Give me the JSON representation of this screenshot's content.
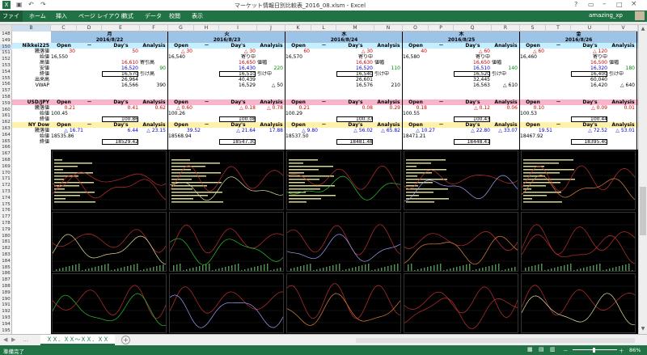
{
  "window": {
    "title": "マーケット情報日別比較表_2016_08.xlsm - Excel",
    "user": "amazing_xp"
  },
  "ribbon": {
    "tabs": [
      "ファイル",
      "ホーム",
      "挿入",
      "ページ レイアウト",
      "数式",
      "データ",
      "校閲",
      "表示"
    ]
  },
  "name_box": "B150",
  "columns": [
    "B",
    "C",
    "D",
    "E",
    "F",
    "G",
    "H",
    "I",
    "J",
    "K",
    "L",
    "M",
    "N",
    "O",
    "P",
    "Q",
    "R",
    "S",
    "T",
    "U",
    "V"
  ],
  "rows": [
    "148",
    "149",
    "150",
    "151",
    "152",
    "153",
    "154",
    "155",
    "156",
    "157",
    "158",
    "159",
    "160",
    "161",
    "162",
    "163",
    "164",
    "165",
    "166",
    "167",
    "168",
    "169",
    "170",
    "171",
    "172",
    "173",
    "174",
    "175",
    "176",
    "177",
    "178",
    "179",
    "180",
    "181",
    "182",
    "183",
    "184",
    "185",
    "186",
    "187",
    "188",
    "189",
    "190",
    "191",
    "192",
    "193",
    "194",
    "195"
  ],
  "row_labels": {
    "nikkei": "Nikkei225",
    "prev_close": "騰落値",
    "open_price": "始値",
    "high": "高値",
    "low": "安値",
    "close": "終値",
    "volume": "出来高",
    "vwap": "VWAP",
    "usdjpy": "USD/JPY",
    "nydow": "NY Dow"
  },
  "headers": {
    "open": "Open",
    "dash": "－",
    "days": "Day's",
    "analysis": "Analysis"
  },
  "days": [
    {
      "wday": "月",
      "date": "2016/8/22",
      "nk": {
        "chg": "30",
        "dchg": "50",
        "open": "16,550",
        "high": "16,610",
        "low": "16,520",
        "close": "16,570",
        "vol": "26,964",
        "vwap": "16,566",
        "tag1": "",
        "tag2": "寄引高",
        "tag3": "",
        "tag4": "引け高",
        "v1": "90",
        "v2": "390"
      },
      "fx": {
        "chg": "0.21",
        "dchg": "0.41",
        "ana": "0.62",
        "open": "100.45",
        "close": "100.86"
      },
      "dw": {
        "chg": "△ 16.71",
        "dchg": "6.44",
        "ana": "△ 23.15",
        "open": "18535.86",
        "close": "18529.42"
      }
    },
    {
      "wday": "火",
      "date": "2016/8/23",
      "nk": {
        "chg": "△ 30",
        "dchg": "△ 30",
        "open": "16,540",
        "high": "16,650",
        "low": "16,430",
        "close": "16,510",
        "vol": "40,439",
        "vwap": "16,529",
        "tag1": "寄り中",
        "tag2": "値幅",
        "tag3": "",
        "tag4": "引け中",
        "v1": "220",
        "v2": "△ 50"
      },
      "fx": {
        "chg": "△ 0.60",
        "dchg": "△ 0.18",
        "ana": "△ 0.78",
        "open": "100.26",
        "close": "100.08"
      },
      "dw": {
        "chg": "39.52",
        "dchg": "△ 21.64",
        "ana": "17.88",
        "open": "18568.94",
        "close": "18547.30"
      }
    },
    {
      "wday": "水",
      "date": "2016/8/24",
      "nk": {
        "chg": "60",
        "dchg": "△ 30",
        "open": "16,570",
        "high": "16,630",
        "low": "16,520",
        "close": "16,540",
        "vol": "26,601",
        "vwap": "16,576",
        "tag1": "寄り中",
        "tag2": "値幅",
        "tag3": "",
        "tag4": "引け中",
        "v1": "110",
        "v2": "210"
      },
      "fx": {
        "chg": "0.21",
        "dchg": "0.08",
        "ana": "0.29",
        "open": "100.29",
        "close": "100.37"
      },
      "dw": {
        "chg": "△ 9.80",
        "dchg": "△ 56.02",
        "ana": "△ 65.82",
        "open": "18537.50",
        "close": "18481.48"
      }
    },
    {
      "wday": "木",
      "date": "2016/8/25",
      "nk": {
        "chg": "40",
        "dchg": "△ 60",
        "open": "16,580",
        "high": "16,650",
        "low": "16,510",
        "close": "16,520",
        "vol": "32,445",
        "vwap": "16,563",
        "tag1": "寄り中",
        "tag2": "値幅",
        "tag3": "",
        "tag4": "引け中",
        "v1": "140",
        "v2": "△ 610"
      },
      "fx": {
        "chg": "0.18",
        "dchg": "△ 0.12",
        "ana": "0.06",
        "open": "100.55",
        "close": "100.43"
      },
      "dw": {
        "chg": "△ 10.27",
        "dchg": "△ 22.80",
        "ana": "△ 33.07",
        "open": "18471.21",
        "close": "18448.41"
      }
    },
    {
      "wday": "金",
      "date": "2016/8/26",
      "nk": {
        "chg": "△ 60",
        "dchg": "△ 120",
        "open": "16,460",
        "high": "16,500",
        "low": "16,320",
        "close": "16,400",
        "vol": "60,040",
        "vwap": "16,420",
        "tag1": "寄り中",
        "tag2": "値幅",
        "tag3": "",
        "tag4": "引け中",
        "v1": "180",
        "v2": "△ 640"
      },
      "fx": {
        "chg": "0.10",
        "dchg": "△ 0.09",
        "ana": "0.01",
        "open": "100.53",
        "close": "100.44"
      },
      "dw": {
        "chg": "19.51",
        "dchg": "△ 72.52",
        "ana": "△ 53.01",
        "open": "18467.92",
        "close": "18395.40"
      }
    }
  ],
  "sheet": {
    "tab": "ＸＸ．ＸＸ～ＸＸ．ＸＸ"
  },
  "status": {
    "ready": "準備完了",
    "zoom": "86%"
  }
}
